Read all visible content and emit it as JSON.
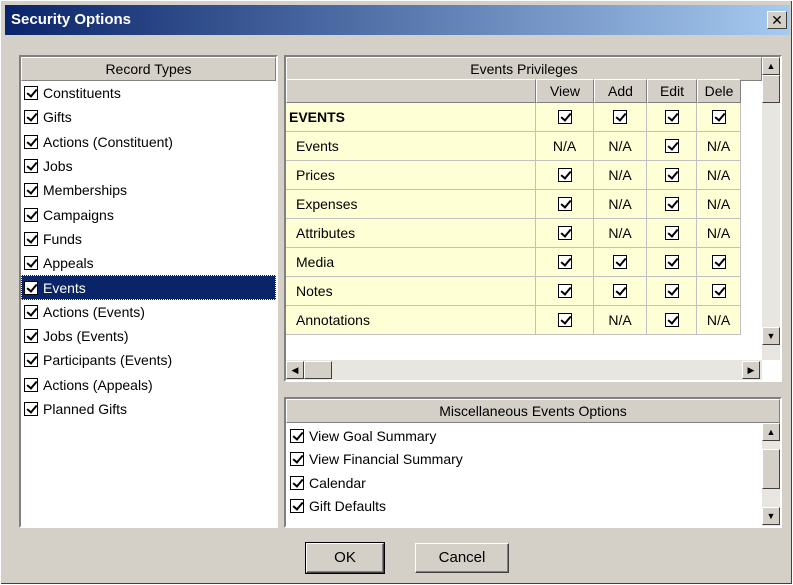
{
  "window": {
    "title": "Security Options",
    "close_glyph": "✕"
  },
  "record_types": {
    "header": "Record Types",
    "selected_index": 8,
    "items": [
      "Constituents",
      "Gifts",
      "Actions (Constituent)",
      "Jobs",
      "Memberships",
      "Campaigns",
      "Funds",
      "Appeals",
      "Events",
      "Actions (Events)",
      "Jobs (Events)",
      "Participants (Events)",
      "Actions (Appeals)",
      "Planned Gifts"
    ]
  },
  "privileges": {
    "header": "Events Privileges",
    "columns": [
      "View",
      "Add",
      "Edit",
      "Dele"
    ],
    "rows": [
      {
        "name": "EVENTS",
        "bold": true,
        "cells": [
          "check",
          "check",
          "check",
          "check"
        ]
      },
      {
        "name": "Events",
        "cells": [
          "N/A",
          "N/A",
          "check",
          "N/A"
        ]
      },
      {
        "name": "Prices",
        "cells": [
          "check",
          "N/A",
          "check",
          "N/A"
        ]
      },
      {
        "name": "Expenses",
        "cells": [
          "check",
          "N/A",
          "check",
          "N/A"
        ]
      },
      {
        "name": "Attributes",
        "cells": [
          "check",
          "N/A",
          "check",
          "N/A"
        ]
      },
      {
        "name": "Media",
        "cells": [
          "check",
          "check",
          "check",
          "check"
        ]
      },
      {
        "name": "Notes",
        "cells": [
          "check",
          "check",
          "check",
          "check"
        ]
      },
      {
        "name": "Annotations",
        "cells": [
          "check",
          "N/A",
          "check",
          "N/A"
        ]
      }
    ]
  },
  "misc": {
    "header": "Miscellaneous Events Options",
    "items": [
      "View Goal Summary",
      "View Financial Summary",
      "Calendar",
      "Gift Defaults"
    ]
  },
  "buttons": {
    "ok": "OK",
    "cancel": "Cancel"
  },
  "icons": {
    "up": "▲",
    "down": "▼",
    "left": "◀",
    "right": "▶"
  }
}
